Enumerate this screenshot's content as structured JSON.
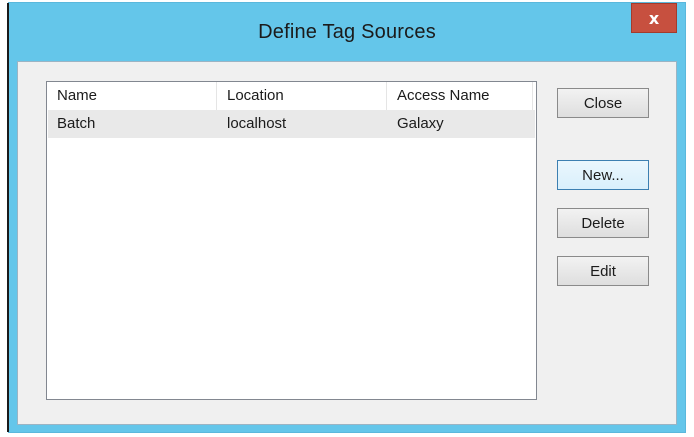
{
  "window": {
    "title": "Define Tag Sources",
    "close_glyph": "x"
  },
  "list": {
    "columns": [
      "Name",
      "Location",
      "Access Name"
    ],
    "rows": [
      {
        "name": "Batch",
        "location": "localhost",
        "access_name": "Galaxy"
      }
    ]
  },
  "buttons": {
    "close": "Close",
    "new": "New...",
    "delete": "Delete",
    "edit": "Edit"
  },
  "colors": {
    "titlebar": "#64c6ea",
    "close_button": "#c7503f",
    "selected_row": "#e9e9e9"
  },
  "icons": {
    "close": "close-icon"
  }
}
